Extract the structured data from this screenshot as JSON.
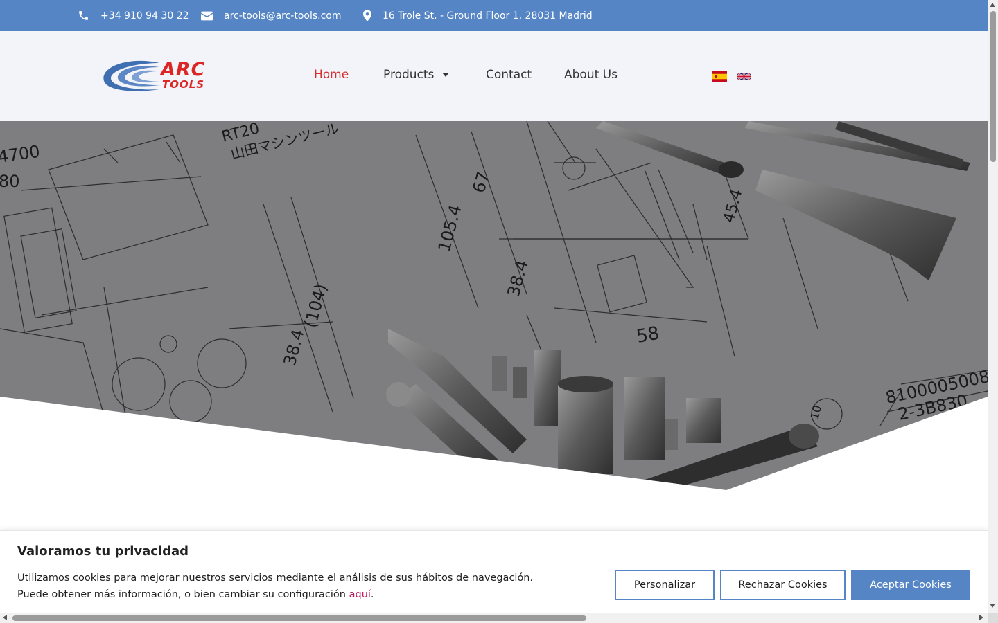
{
  "topbar": {
    "phone": "+34 910 94 30 22",
    "email": "arc-tools@arc-tools.com",
    "address": "16 Trole St. - Ground Floor 1, 28031 Madrid",
    "icons": [
      "phone-icon",
      "envelope-icon",
      "map-pin-icon"
    ]
  },
  "header": {
    "logo": {
      "line1": "ARC",
      "line2": "TOOLS"
    },
    "nav": [
      {
        "label": "Home",
        "active": true
      },
      {
        "label": "Products",
        "has_dropdown": true
      },
      {
        "label": "Contact"
      },
      {
        "label": "About Us"
      }
    ],
    "languages": [
      "es-flag-icon",
      "uk-flag-icon"
    ]
  },
  "hero": {
    "drawing_labels": [
      "4700",
      "80",
      "RT20",
      "山田マシンツール",
      "105.4",
      "67",
      "38.4",
      "(104)",
      "38.4",
      "58",
      "45.4",
      "8100005008",
      "2-3B830",
      "10"
    ]
  },
  "cookie": {
    "title": "Valoramos tu privacidad",
    "line1": "Utilizamos cookies para mejorar nuestros servicios mediante el análisis de sus hábitos de navegación.",
    "line2_prefix": "Puede obtener más información, o bien cambiar su configuración ",
    "line2_link": "aquí",
    "line2_suffix": ".",
    "buttons": {
      "customize": "Personalizar",
      "reject": "Rechazar Cookies",
      "accept": "Aceptar Cookies"
    }
  },
  "colors": {
    "topbar_bg": "#5585c5",
    "header_bg": "#f2f4f9",
    "nav_active": "#d32f2f",
    "logo_red": "#dc2626",
    "logo_blue": "#3f6fb0",
    "link": "#c2185b"
  }
}
